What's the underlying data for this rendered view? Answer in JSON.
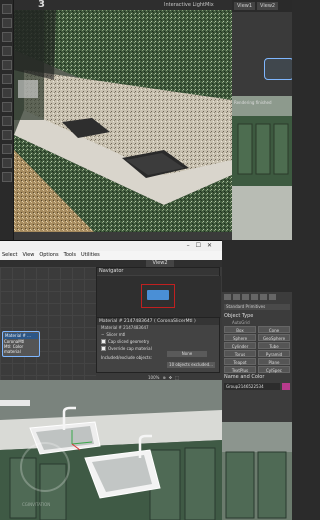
{
  "top_window": {
    "title": "Interactive LightMix",
    "number": "3",
    "view_tabs": [
      "View1",
      "View2"
    ],
    "mini_view_label": "Rendering finished"
  },
  "slate": {
    "menu": [
      "Select",
      "View",
      "Options",
      "Tools",
      "Utilities"
    ],
    "view_tab": "View2",
    "navigator_title": "Navigator",
    "node": {
      "title": "Material # ...",
      "subtitle": "CoronaMtl",
      "footer": "Mtl: Color material"
    },
    "material_panel": {
      "header": "Material # 2147483647 ( CoronaSlicerMtl )",
      "sub": "Material # 2147483647",
      "section": "Slicer mtl",
      "row1": "Cap sliced geometry",
      "row2": "Override cap material",
      "row2_btn": "None",
      "row3": "Included/exclude objects:",
      "row3_btn": "10 objects excluded..."
    },
    "zoom": "100%"
  },
  "command_panel": {
    "dropdown": "Standard Primitives",
    "section_object_type": "Object Type",
    "autogrid": "AutoGrid",
    "primitives": [
      "Box",
      "Cone",
      "Sphere",
      "GeoSphere",
      "Cylinder",
      "Tube",
      "Torus",
      "Pyramid",
      "Teapot",
      "Plane",
      "TextPlus",
      "CylSpec"
    ],
    "section_name_color": "Name and Color",
    "name_value": "Group2146522534"
  },
  "watermark_text": "CGINVITATION"
}
